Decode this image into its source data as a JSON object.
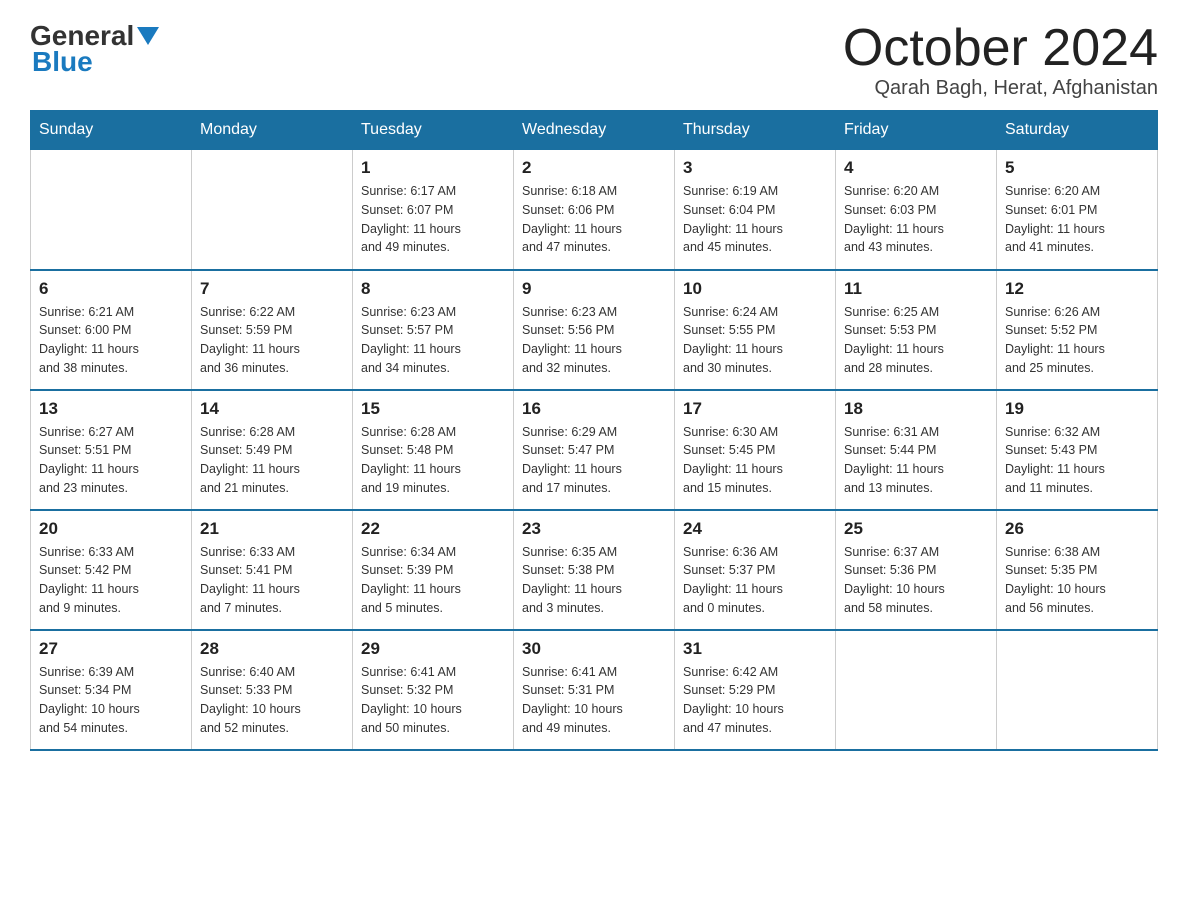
{
  "header": {
    "logo_general": "General",
    "logo_blue": "Blue",
    "month": "October 2024",
    "location": "Qarah Bagh, Herat, Afghanistan"
  },
  "weekdays": [
    "Sunday",
    "Monday",
    "Tuesday",
    "Wednesday",
    "Thursday",
    "Friday",
    "Saturday"
  ],
  "weeks": [
    [
      {
        "day": "",
        "info": ""
      },
      {
        "day": "",
        "info": ""
      },
      {
        "day": "1",
        "info": "Sunrise: 6:17 AM\nSunset: 6:07 PM\nDaylight: 11 hours\nand 49 minutes."
      },
      {
        "day": "2",
        "info": "Sunrise: 6:18 AM\nSunset: 6:06 PM\nDaylight: 11 hours\nand 47 minutes."
      },
      {
        "day": "3",
        "info": "Sunrise: 6:19 AM\nSunset: 6:04 PM\nDaylight: 11 hours\nand 45 minutes."
      },
      {
        "day": "4",
        "info": "Sunrise: 6:20 AM\nSunset: 6:03 PM\nDaylight: 11 hours\nand 43 minutes."
      },
      {
        "day": "5",
        "info": "Sunrise: 6:20 AM\nSunset: 6:01 PM\nDaylight: 11 hours\nand 41 minutes."
      }
    ],
    [
      {
        "day": "6",
        "info": "Sunrise: 6:21 AM\nSunset: 6:00 PM\nDaylight: 11 hours\nand 38 minutes."
      },
      {
        "day": "7",
        "info": "Sunrise: 6:22 AM\nSunset: 5:59 PM\nDaylight: 11 hours\nand 36 minutes."
      },
      {
        "day": "8",
        "info": "Sunrise: 6:23 AM\nSunset: 5:57 PM\nDaylight: 11 hours\nand 34 minutes."
      },
      {
        "day": "9",
        "info": "Sunrise: 6:23 AM\nSunset: 5:56 PM\nDaylight: 11 hours\nand 32 minutes."
      },
      {
        "day": "10",
        "info": "Sunrise: 6:24 AM\nSunset: 5:55 PM\nDaylight: 11 hours\nand 30 minutes."
      },
      {
        "day": "11",
        "info": "Sunrise: 6:25 AM\nSunset: 5:53 PM\nDaylight: 11 hours\nand 28 minutes."
      },
      {
        "day": "12",
        "info": "Sunrise: 6:26 AM\nSunset: 5:52 PM\nDaylight: 11 hours\nand 25 minutes."
      }
    ],
    [
      {
        "day": "13",
        "info": "Sunrise: 6:27 AM\nSunset: 5:51 PM\nDaylight: 11 hours\nand 23 minutes."
      },
      {
        "day": "14",
        "info": "Sunrise: 6:28 AM\nSunset: 5:49 PM\nDaylight: 11 hours\nand 21 minutes."
      },
      {
        "day": "15",
        "info": "Sunrise: 6:28 AM\nSunset: 5:48 PM\nDaylight: 11 hours\nand 19 minutes."
      },
      {
        "day": "16",
        "info": "Sunrise: 6:29 AM\nSunset: 5:47 PM\nDaylight: 11 hours\nand 17 minutes."
      },
      {
        "day": "17",
        "info": "Sunrise: 6:30 AM\nSunset: 5:45 PM\nDaylight: 11 hours\nand 15 minutes."
      },
      {
        "day": "18",
        "info": "Sunrise: 6:31 AM\nSunset: 5:44 PM\nDaylight: 11 hours\nand 13 minutes."
      },
      {
        "day": "19",
        "info": "Sunrise: 6:32 AM\nSunset: 5:43 PM\nDaylight: 11 hours\nand 11 minutes."
      }
    ],
    [
      {
        "day": "20",
        "info": "Sunrise: 6:33 AM\nSunset: 5:42 PM\nDaylight: 11 hours\nand 9 minutes."
      },
      {
        "day": "21",
        "info": "Sunrise: 6:33 AM\nSunset: 5:41 PM\nDaylight: 11 hours\nand 7 minutes."
      },
      {
        "day": "22",
        "info": "Sunrise: 6:34 AM\nSunset: 5:39 PM\nDaylight: 11 hours\nand 5 minutes."
      },
      {
        "day": "23",
        "info": "Sunrise: 6:35 AM\nSunset: 5:38 PM\nDaylight: 11 hours\nand 3 minutes."
      },
      {
        "day": "24",
        "info": "Sunrise: 6:36 AM\nSunset: 5:37 PM\nDaylight: 11 hours\nand 0 minutes."
      },
      {
        "day": "25",
        "info": "Sunrise: 6:37 AM\nSunset: 5:36 PM\nDaylight: 10 hours\nand 58 minutes."
      },
      {
        "day": "26",
        "info": "Sunrise: 6:38 AM\nSunset: 5:35 PM\nDaylight: 10 hours\nand 56 minutes."
      }
    ],
    [
      {
        "day": "27",
        "info": "Sunrise: 6:39 AM\nSunset: 5:34 PM\nDaylight: 10 hours\nand 54 minutes."
      },
      {
        "day": "28",
        "info": "Sunrise: 6:40 AM\nSunset: 5:33 PM\nDaylight: 10 hours\nand 52 minutes."
      },
      {
        "day": "29",
        "info": "Sunrise: 6:41 AM\nSunset: 5:32 PM\nDaylight: 10 hours\nand 50 minutes."
      },
      {
        "day": "30",
        "info": "Sunrise: 6:41 AM\nSunset: 5:31 PM\nDaylight: 10 hours\nand 49 minutes."
      },
      {
        "day": "31",
        "info": "Sunrise: 6:42 AM\nSunset: 5:29 PM\nDaylight: 10 hours\nand 47 minutes."
      },
      {
        "day": "",
        "info": ""
      },
      {
        "day": "",
        "info": ""
      }
    ]
  ]
}
